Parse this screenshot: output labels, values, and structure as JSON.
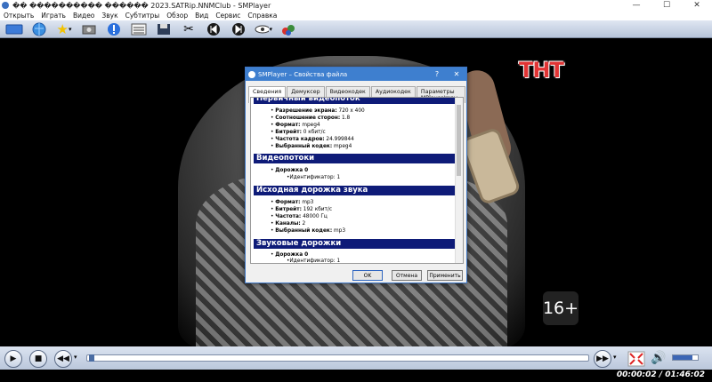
{
  "window": {
    "title": "�� ���������� ������ 2023.SATRip.NNMClub - SMPlayer",
    "minimize": "—",
    "maximize": "☐",
    "close": "✕"
  },
  "menu": [
    "Открыть",
    "Играть",
    "Видео",
    "Звук",
    "Субтитры",
    "Обзор",
    "Вид",
    "Сервис",
    "Справка"
  ],
  "toolbar_icons": [
    "monitor-icon",
    "globe-icon",
    "star-icon",
    "screenshot-icon",
    "info-icon",
    "playlist-icon",
    "save-icon",
    "tools-icon",
    "skip-back-icon",
    "skip-forward-icon",
    "eye-icon",
    "mixer-icon"
  ],
  "video": {
    "channel_logo": "ТНТ",
    "age_rating": "16+"
  },
  "player": {
    "time": "00:00:02 / 01:46:02",
    "volume_percent": 80,
    "seek_percent": 0.3
  },
  "dialog": {
    "title": "SMPlayer – Свойства файла",
    "help": "?",
    "close": "✕",
    "tabs": [
      "Сведения",
      "Демуксер",
      "Видеокодек",
      "Аудиокодек",
      "Параметры MPlayer/mpv"
    ],
    "sections": {
      "video_main": "Первичный видеопоток",
      "video_tracks": "Видеопотоки",
      "audio_main": "Исходная дорожка звука",
      "audio_tracks": "Звуковые дорожки"
    },
    "video_props": [
      {
        "label": "Разрешение экрана:",
        "value": "720 x 400"
      },
      {
        "label": "Соотношение сторон:",
        "value": "1.8"
      },
      {
        "label": "Формат:",
        "value": "mpeg4"
      },
      {
        "label": "Битрейт:",
        "value": "0 кбит/с"
      },
      {
        "label": "Частота кадров:",
        "value": "24.999844"
      },
      {
        "label": "Выбранный кодек:",
        "value": "mpeg4"
      }
    ],
    "video_track": {
      "label": "Дорожка 0",
      "id_label": "Идентификатор:",
      "id_value": "1"
    },
    "audio_props": [
      {
        "label": "Формат:",
        "value": "mp3"
      },
      {
        "label": "Битрейт:",
        "value": "192 кбит/с"
      },
      {
        "label": "Частота:",
        "value": "48000 Гц"
      },
      {
        "label": "Каналы:",
        "value": "2"
      },
      {
        "label": "Выбранный кодек:",
        "value": "mp3"
      }
    ],
    "audio_track": {
      "label": "Дорожка 0",
      "id_label": "Идентификатор:",
      "id_value": "1"
    },
    "buttons": {
      "ok": "OK",
      "cancel": "Отмена",
      "apply": "Применить"
    }
  }
}
